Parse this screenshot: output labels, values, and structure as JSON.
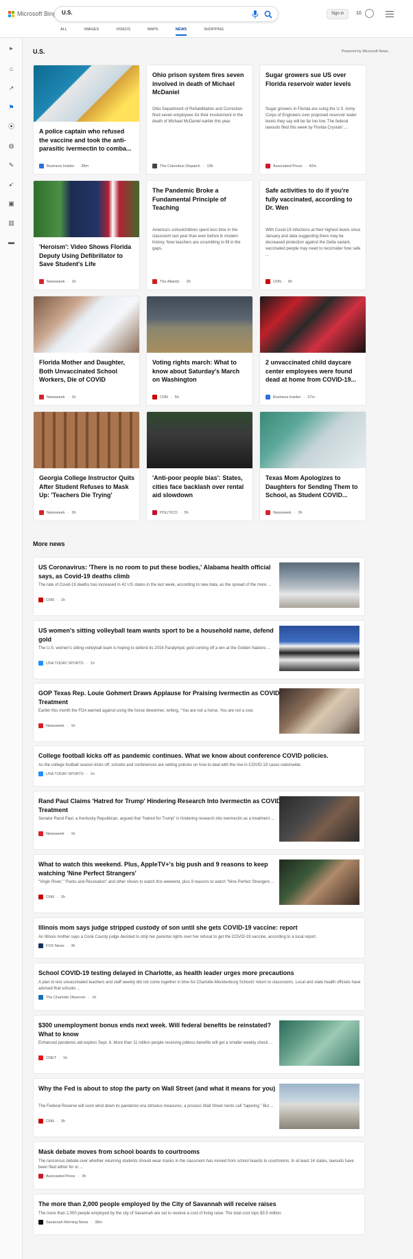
{
  "header": {
    "brand": "Microsoft Bing",
    "search_value": "U.S.",
    "signin": "Sign in",
    "points": "10"
  },
  "nav": [
    "ALL",
    "IMAGES",
    "VIDEOS",
    "MAPS",
    "NEWS",
    "SHOPPING"
  ],
  "section": {
    "title": "U.S.",
    "powered_by": "Powered by Microsoft News"
  },
  "cards": [
    {
      "title": "A police captain who refused the vaccine and took the anti-parasitic ivermectin to comba...",
      "source": "Business Insider",
      "time": "28m"
    },
    {
      "title": "Ohio prison system fires seven involved in death of Michael McDaniel",
      "snippet": "Ohio Department of Rehabilitation and Correction fired seven employees for their involvement in the death of Michael McDaniel earlier this year.",
      "source": "The Columbus Dispatch",
      "time": "19h"
    },
    {
      "title": "Sugar growers sue US over Florida reservoir water levels",
      "snippet": "Sugar growers in Florida are suing the U.S. Army Corps of Engineers over proposed reservoir water levels they say will be far too low. The federal lawsuits filed this week by Florida Crystals' ...",
      "source": "Associated Press",
      "time": "42m"
    },
    {
      "title": "'Heroism': Video Shows Florida Deputy Using Defibrillator to Save Student's Life",
      "source": "Newsweek",
      "time": "1h"
    },
    {
      "title": "The Pandemic Broke a Fundamental Principle of Teaching",
      "snippet": "America's schoolchildren spent less time in the classroom last year than ever before in modern history. Now teachers are scrambling to fill in the gaps.",
      "source": "The Atlantic",
      "time": "2h"
    },
    {
      "title": "Safe activities to do if you're fully vaccinated, according to Dr. Wen",
      "snippet": "With Covid-19 infections at their highest levels since January and data suggesting there may be decreased protection against the Delta variant, vaccinated people may need to reconsider how safe ...",
      "source": "CNN",
      "time": "9h"
    },
    {
      "title": "Florida Mother and Daughter, Both Unvaccinated School Workers, Die of COVID",
      "source": "Newsweek",
      "time": "1h"
    },
    {
      "title": "Voting rights march: What to know about Saturday's March on Washington",
      "source": "CNN",
      "time": "5h"
    },
    {
      "title": "2 unvaccinated child daycare center employees were found dead at home from COVID-19...",
      "source": "Business Insider",
      "time": "27m"
    },
    {
      "title": "Georgia College Instructor Quits After Student Refuses to Mask Up: 'Teachers Die Trying'",
      "source": "Newsweek",
      "time": "2h"
    },
    {
      "title": "'Anti-poor people bias': States, cities face backlash over rental aid slowdown",
      "source": "POLITICO",
      "time": "5h"
    },
    {
      "title": "Texas Mom Apologizes to Daughters for Sending Them to School, as Student COVID...",
      "source": "Newsweek",
      "time": "2h"
    }
  ],
  "more_news_title": "More news",
  "more": [
    {
      "title": "US Coronavirus: 'There is no room to put these bodies,' Alabama health official says, as Covid-19 deaths climb",
      "snippet": "The rate of Covid-19 deaths has increased in 42 US states in the last week, according to new data, as the spread of the more ...",
      "source": "CNN",
      "time": "1h"
    },
    {
      "title": "US women's sitting volleyball team wants sport to be a household name, defend gold",
      "snippet": "The U.S. women's sitting volleyball team is hoping to defend its 2016 Paralympic gold coming off a win at the Golden Nations ...",
      "source": "USA TODAY SPORTS",
      "time": "1h"
    },
    {
      "title": "GOP Texas Rep. Louie Gohmert Draws Applause for Praising Ivermectin as COVID Treatment",
      "snippet": "Earlier this month the FDA warned against using the horse dewormer, writing, \"You are not a horse. You are not a cow.",
      "source": "Newsweek",
      "time": "1h"
    },
    {
      "title": "College football kicks off as pandemic continues. What we know about conference COVID policies.",
      "snippet": "As the college football season kicks off, schools and conferences are setting policies on how to deal with the rise in COVID-19 cases nationwide.",
      "source": "USA TODAY SPORTS",
      "time": "1h"
    },
    {
      "title": "Rand Paul Claims 'Hatred for Trump' Hindering Research Into Ivermectin as COVID Treatment",
      "snippet": "Senator Rand Paul, a Kentucky Republican, argued that \"hatred for Trump\" is hindering research into ivermectin as a treatment ...",
      "source": "Newsweek",
      "time": "1h"
    },
    {
      "title": "What to watch this weekend. Plus, AppleTV+'s big push and 9 reasons to keep watching 'Nine Perfect Strangers'",
      "snippet": "\"Virgin River,\" \"Parks and Recreation\" and other shows to watch this weekend, plus 9 reasons to watch \"Nine Perfect Strangers ...",
      "source": "CNN",
      "time": "2h"
    },
    {
      "title": "Illinois mom says judge stripped custody of son until she gets COVID-19 vaccine: report",
      "snippet": "An Illinois mother says a Cook County judge decided to strip her parental rights over her refusal to get the COVID-19 vaccine, according to a local report.",
      "source": "FOX News",
      "time": "3h"
    },
    {
      "title": "School COVID-19 testing delayed in Charlotte, as health leader urges more precautions",
      "snippet": "A plan to test unvaccinated teachers and staff weekly did not come together in time for Charlotte-Mecklenburg Schools' return to classrooms. Local and state health officials have advised that schools ...",
      "source": "The Charlotte Observer",
      "time": "1h"
    },
    {
      "title": "$300 unemployment bonus ends next week. Will federal benefits be reinstated? What to know",
      "snippet": "Enhanced pandemic aid expires Sept. 6. More than 11 million people receiving jobless benefits will get a smaller weekly check ...",
      "source": "CNET",
      "time": "1h"
    },
    {
      "title": "Why the Fed is about to stop the party on Wall Street (and what it means for you)",
      "snippet": "The Federal Reserve will soon wind down its pandemic-era stimulus measures, a process Wall Street nerds call \"tapering.\" But ...",
      "source": "CNN",
      "time": "3h"
    },
    {
      "title": "Mask debate moves from school boards to courtrooms",
      "snippet": "The rancorous debate over whether returning students should wear masks in the classroom has moved from school boards to courtrooms. In at least 14 states, lawsuits have been filed either for or ...",
      "source": "Associated Press",
      "time": "3h"
    },
    {
      "title": "The more than 2,000 people employed by the City of Savannah will receive raises",
      "snippet": "The more than 2,000 people employed by the city of Savannah are set to receive a cost of living raise. The total cost tops $3.5 million.",
      "source": "Savannah Morning News",
      "time": "38m"
    }
  ]
}
